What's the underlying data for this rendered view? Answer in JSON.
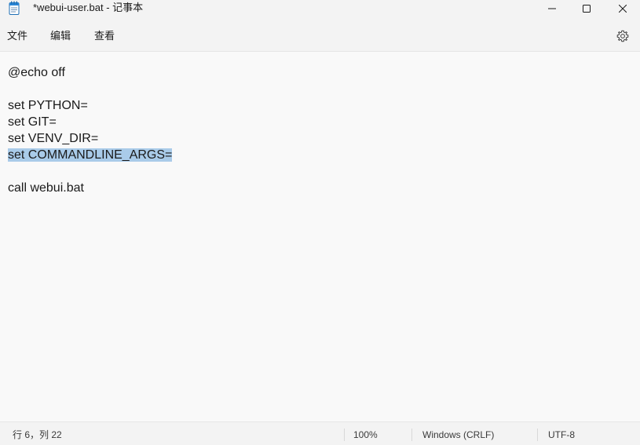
{
  "window": {
    "title": "*webui-user.bat - 记事本",
    "icon": "notepad-icon"
  },
  "menu": {
    "file": "文件",
    "edit": "编辑",
    "view": "查看",
    "settings_icon": "gear-icon"
  },
  "editor": {
    "lines": [
      "@echo off",
      "",
      "set PYTHON=",
      "set GIT=",
      "set VENV_DIR=",
      "set COMMANDLINE_ARGS=",
      "",
      "call webui.bat"
    ],
    "selection_color": "#a9cbe9"
  },
  "status": {
    "position": "行 6，列 22",
    "zoom": "100%",
    "line_ending": "Windows (CRLF)",
    "encoding": "UTF-8"
  }
}
